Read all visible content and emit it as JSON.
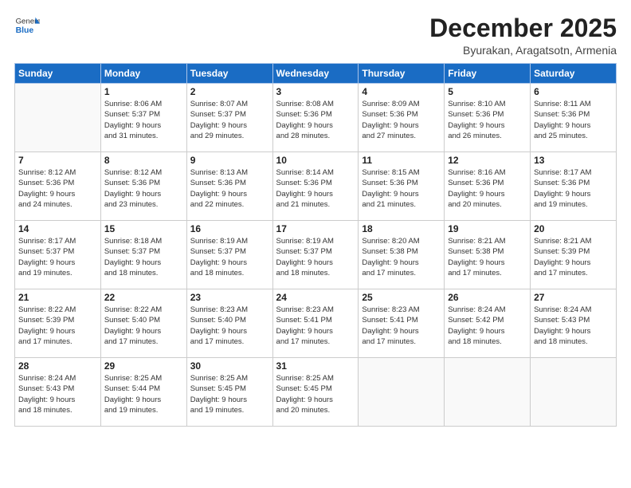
{
  "logo": {
    "general": "General",
    "blue": "Blue"
  },
  "title": "December 2025",
  "location": "Byurakan, Aragatsotn, Armenia",
  "weekdays": [
    "Sunday",
    "Monday",
    "Tuesday",
    "Wednesday",
    "Thursday",
    "Friday",
    "Saturday"
  ],
  "weeks": [
    [
      {
        "day": "",
        "sunrise": "",
        "sunset": "",
        "daylight": ""
      },
      {
        "day": "1",
        "sunrise": "Sunrise: 8:06 AM",
        "sunset": "Sunset: 5:37 PM",
        "daylight": "Daylight: 9 hours and 31 minutes."
      },
      {
        "day": "2",
        "sunrise": "Sunrise: 8:07 AM",
        "sunset": "Sunset: 5:37 PM",
        "daylight": "Daylight: 9 hours and 29 minutes."
      },
      {
        "day": "3",
        "sunrise": "Sunrise: 8:08 AM",
        "sunset": "Sunset: 5:36 PM",
        "daylight": "Daylight: 9 hours and 28 minutes."
      },
      {
        "day": "4",
        "sunrise": "Sunrise: 8:09 AM",
        "sunset": "Sunset: 5:36 PM",
        "daylight": "Daylight: 9 hours and 27 minutes."
      },
      {
        "day": "5",
        "sunrise": "Sunrise: 8:10 AM",
        "sunset": "Sunset: 5:36 PM",
        "daylight": "Daylight: 9 hours and 26 minutes."
      },
      {
        "day": "6",
        "sunrise": "Sunrise: 8:11 AM",
        "sunset": "Sunset: 5:36 PM",
        "daylight": "Daylight: 9 hours and 25 minutes."
      }
    ],
    [
      {
        "day": "7",
        "sunrise": "Sunrise: 8:12 AM",
        "sunset": "Sunset: 5:36 PM",
        "daylight": "Daylight: 9 hours and 24 minutes."
      },
      {
        "day": "8",
        "sunrise": "Sunrise: 8:12 AM",
        "sunset": "Sunset: 5:36 PM",
        "daylight": "Daylight: 9 hours and 23 minutes."
      },
      {
        "day": "9",
        "sunrise": "Sunrise: 8:13 AM",
        "sunset": "Sunset: 5:36 PM",
        "daylight": "Daylight: 9 hours and 22 minutes."
      },
      {
        "day": "10",
        "sunrise": "Sunrise: 8:14 AM",
        "sunset": "Sunset: 5:36 PM",
        "daylight": "Daylight: 9 hours and 21 minutes."
      },
      {
        "day": "11",
        "sunrise": "Sunrise: 8:15 AM",
        "sunset": "Sunset: 5:36 PM",
        "daylight": "Daylight: 9 hours and 21 minutes."
      },
      {
        "day": "12",
        "sunrise": "Sunrise: 8:16 AM",
        "sunset": "Sunset: 5:36 PM",
        "daylight": "Daylight: 9 hours and 20 minutes."
      },
      {
        "day": "13",
        "sunrise": "Sunrise: 8:17 AM",
        "sunset": "Sunset: 5:36 PM",
        "daylight": "Daylight: 9 hours and 19 minutes."
      }
    ],
    [
      {
        "day": "14",
        "sunrise": "Sunrise: 8:17 AM",
        "sunset": "Sunset: 5:37 PM",
        "daylight": "Daylight: 9 hours and 19 minutes."
      },
      {
        "day": "15",
        "sunrise": "Sunrise: 8:18 AM",
        "sunset": "Sunset: 5:37 PM",
        "daylight": "Daylight: 9 hours and 18 minutes."
      },
      {
        "day": "16",
        "sunrise": "Sunrise: 8:19 AM",
        "sunset": "Sunset: 5:37 PM",
        "daylight": "Daylight: 9 hours and 18 minutes."
      },
      {
        "day": "17",
        "sunrise": "Sunrise: 8:19 AM",
        "sunset": "Sunset: 5:37 PM",
        "daylight": "Daylight: 9 hours and 18 minutes."
      },
      {
        "day": "18",
        "sunrise": "Sunrise: 8:20 AM",
        "sunset": "Sunset: 5:38 PM",
        "daylight": "Daylight: 9 hours and 17 minutes."
      },
      {
        "day": "19",
        "sunrise": "Sunrise: 8:21 AM",
        "sunset": "Sunset: 5:38 PM",
        "daylight": "Daylight: 9 hours and 17 minutes."
      },
      {
        "day": "20",
        "sunrise": "Sunrise: 8:21 AM",
        "sunset": "Sunset: 5:39 PM",
        "daylight": "Daylight: 9 hours and 17 minutes."
      }
    ],
    [
      {
        "day": "21",
        "sunrise": "Sunrise: 8:22 AM",
        "sunset": "Sunset: 5:39 PM",
        "daylight": "Daylight: 9 hours and 17 minutes."
      },
      {
        "day": "22",
        "sunrise": "Sunrise: 8:22 AM",
        "sunset": "Sunset: 5:40 PM",
        "daylight": "Daylight: 9 hours and 17 minutes."
      },
      {
        "day": "23",
        "sunrise": "Sunrise: 8:23 AM",
        "sunset": "Sunset: 5:40 PM",
        "daylight": "Daylight: 9 hours and 17 minutes."
      },
      {
        "day": "24",
        "sunrise": "Sunrise: 8:23 AM",
        "sunset": "Sunset: 5:41 PM",
        "daylight": "Daylight: 9 hours and 17 minutes."
      },
      {
        "day": "25",
        "sunrise": "Sunrise: 8:23 AM",
        "sunset": "Sunset: 5:41 PM",
        "daylight": "Daylight: 9 hours and 17 minutes."
      },
      {
        "day": "26",
        "sunrise": "Sunrise: 8:24 AM",
        "sunset": "Sunset: 5:42 PM",
        "daylight": "Daylight: 9 hours and 18 minutes."
      },
      {
        "day": "27",
        "sunrise": "Sunrise: 8:24 AM",
        "sunset": "Sunset: 5:43 PM",
        "daylight": "Daylight: 9 hours and 18 minutes."
      }
    ],
    [
      {
        "day": "28",
        "sunrise": "Sunrise: 8:24 AM",
        "sunset": "Sunset: 5:43 PM",
        "daylight": "Daylight: 9 hours and 18 minutes."
      },
      {
        "day": "29",
        "sunrise": "Sunrise: 8:25 AM",
        "sunset": "Sunset: 5:44 PM",
        "daylight": "Daylight: 9 hours and 19 minutes."
      },
      {
        "day": "30",
        "sunrise": "Sunrise: 8:25 AM",
        "sunset": "Sunset: 5:45 PM",
        "daylight": "Daylight: 9 hours and 19 minutes."
      },
      {
        "day": "31",
        "sunrise": "Sunrise: 8:25 AM",
        "sunset": "Sunset: 5:45 PM",
        "daylight": "Daylight: 9 hours and 20 minutes."
      },
      {
        "day": "",
        "sunrise": "",
        "sunset": "",
        "daylight": ""
      },
      {
        "day": "",
        "sunrise": "",
        "sunset": "",
        "daylight": ""
      },
      {
        "day": "",
        "sunrise": "",
        "sunset": "",
        "daylight": ""
      }
    ]
  ]
}
